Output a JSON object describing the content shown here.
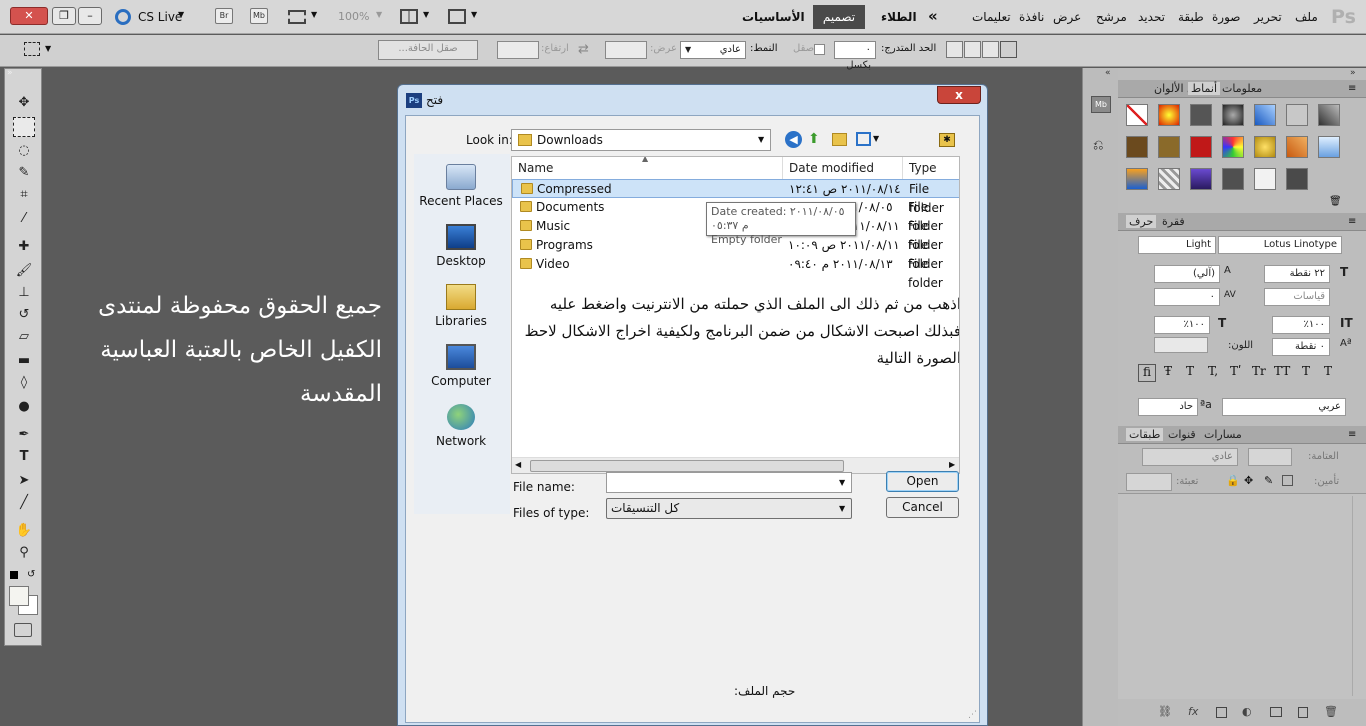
{
  "app": {
    "ps_logo": "Ps",
    "cs_live": "CS Live",
    "zoom": "100%",
    "btn_br": "Br",
    "btn_mb": "Mb",
    "workspaces": {
      "essentials": "الأساسيات",
      "design": "تصميم",
      "painting": "الطلاء"
    },
    "menus": [
      "ملف",
      "تحرير",
      "صورة",
      "طبقة",
      "تحديد",
      "مرشح",
      "عرض",
      "نافذة",
      "تعليمات"
    ]
  },
  "options": {
    "feather_label": "الحد المتدرج:",
    "feather_value": "٠ بكسل",
    "antialias_label": "صقل",
    "style_label": "النمط:",
    "style_value": "عادي",
    "width_label": "عرض:",
    "height_label": "ارتفاع:",
    "refine_edge": "صقل الحافة..."
  },
  "watermark": {
    "text": "جميع الحقوق محفوظة لمنتدى الكفيل الخاص بالعتبة العباسية المقدسة"
  },
  "dialog": {
    "title": "فتح",
    "close_glyph": "x",
    "look_in_label": "Look in:",
    "look_in_value": "Downloads",
    "places": [
      {
        "label": "Recent Places",
        "icon": "recent-places-icon"
      },
      {
        "label": "Desktop",
        "icon": "desktop-icon"
      },
      {
        "label": "Libraries",
        "icon": "libraries-icon"
      },
      {
        "label": "Computer",
        "icon": "computer-icon"
      },
      {
        "label": "Network",
        "icon": "network-icon"
      }
    ],
    "columns": {
      "name": "Name",
      "date": "Date modified",
      "type": "Type"
    },
    "files": [
      {
        "name": "Compressed",
        "date": "٢٠١١/٠٨/١٤ ص ١٢:٤١",
        "type": "File folder"
      },
      {
        "name": "Documents",
        "date": "٢٠١١/٠٨/٠٥ م ٠٥:٣٧",
        "type": "File folder"
      },
      {
        "name": "Music",
        "date": "٢٠١١/٠٨/١١ ص ١٠:٠٩",
        "type": "File folder"
      },
      {
        "name": "Programs",
        "date": "٢٠١١/٠٨/١١ ص ١٠:٠٩",
        "type": "File folder"
      },
      {
        "name": "Video",
        "date": "٢٠١١/٠٨/١٣ م ٠٩:٤٠",
        "type": "File folder"
      }
    ],
    "tooltip": {
      "line1": "Date created: ٢٠١١/٠٨/٠٥ م ٠٥:٣٧",
      "line2": "Empty folder"
    },
    "overlay_text": "اذهب من ثم ذلك الى الملف الذي حملته من الانترنيت واضغط عليه فبذلك اصبحت الاشكال من ضمن البرنامج ولكيفية اخراج الاشكال لاحظ الصورة التالية",
    "filename_label": "File name:",
    "filename_value": "",
    "filetype_label": "Files of type:",
    "filetype_value": "كل التنسيقات",
    "open_button": "Open",
    "cancel_button": "Cancel",
    "filesize_label": "حجم الملف:"
  },
  "panels": {
    "swatches_tabs": [
      "معلومات",
      "حامل الألوان",
      "أنماط"
    ],
    "char_tabs": [
      "فقرة",
      "حرف"
    ],
    "font_family": "Lotus Linotype",
    "font_style": "Light",
    "font_size": "٢٢ نقطة",
    "leading": "(آلي)",
    "tracking_label": "قياسات",
    "tracking_value": "٠",
    "vscale": "١٠٠٪",
    "hscale": "١٠٠٪",
    "baseline": "٠ نقطة",
    "color_label": "اللون:",
    "language": "عربي",
    "aa": "حاد",
    "layers_tabs": [
      "طبقات",
      "قنوات",
      "مسارات"
    ],
    "blend_mode": "عادي",
    "opacity_label": "العتامة:",
    "lock_label": "تأمين:",
    "fill_label": "تعبئة:"
  }
}
